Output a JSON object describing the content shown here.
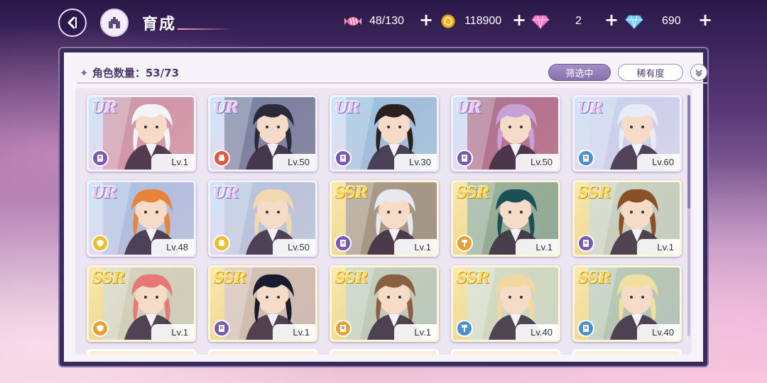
{
  "header": {
    "title": "育成",
    "resources": [
      {
        "name": "candy",
        "icon": "candy-icon",
        "value": "48/130"
      },
      {
        "name": "coin",
        "icon": "coin-icon",
        "value": "118900"
      },
      {
        "name": "pink-gem",
        "icon": "pink-diamond-icon",
        "value": "2"
      },
      {
        "name": "blue-gem",
        "icon": "blue-diamond-icon",
        "value": "690"
      }
    ]
  },
  "panel": {
    "count_label": "角色数量：53/73",
    "filter_label": "筛选中",
    "sort_label": "稀有度"
  },
  "cards": [
    {
      "rarity": "UR",
      "level": "Lv.1",
      "attr": "purple",
      "icon": "book-icon",
      "bg": "#c06070",
      "hair": "#f4f4f8"
    },
    {
      "rarity": "UR",
      "level": "Lv.50",
      "attr": "red",
      "icon": "fist-icon",
      "bg": "#2a3a60",
      "hair": "#2a2a38"
    },
    {
      "rarity": "UR",
      "level": "Lv.30",
      "attr": "purple",
      "icon": "book-icon",
      "bg": "#6aa8c8",
      "hair": "#2a2020"
    },
    {
      "rarity": "UR",
      "level": "Lv.50",
      "attr": "purple",
      "icon": "book-icon",
      "bg": "#8a2040",
      "hair": "#c8a0d8"
    },
    {
      "rarity": "UR",
      "level": "Lv.60",
      "attr": "blue",
      "icon": "book-icon",
      "bg": "#b8c8e8",
      "hair": "#e8ecf8"
    },
    {
      "rarity": "UR",
      "level": "Lv.48",
      "attr": "yellow",
      "icon": "shield-icon",
      "bg": "#88a8d0",
      "hair": "#e8843a"
    },
    {
      "rarity": "UR",
      "level": "Lv.50",
      "attr": "yellow",
      "icon": "fist-icon",
      "bg": "#98b0c8",
      "hair": "#f0d8b0"
    },
    {
      "rarity": "SSR",
      "level": "Lv.1",
      "attr": "purple",
      "icon": "book-icon",
      "bg": "#6a6078",
      "hair": "#e8e8f0"
    },
    {
      "rarity": "SSR",
      "level": "Lv.1",
      "attr": "orange",
      "icon": "hammer-icon",
      "bg": "#4a8898",
      "hair": "#1a5058"
    },
    {
      "rarity": "SSR",
      "level": "Lv.1",
      "attr": "purple",
      "icon": "book-icon",
      "bg": "#a8c8e0",
      "hair": "#8a5028"
    },
    {
      "rarity": "SSR",
      "level": "Lv.1",
      "attr": "orange",
      "icon": "shield-icon",
      "bg": "#b8c8d8",
      "hair": "#e87878"
    },
    {
      "rarity": "SSR",
      "level": "Lv.1",
      "attr": "purple",
      "icon": "book-icon",
      "bg": "#b8a8c8",
      "hair": "#1a1a30"
    },
    {
      "rarity": "SSR",
      "level": "Lv.1",
      "attr": "orange",
      "icon": "book-icon",
      "bg": "#98c0d8",
      "hair": "#8a6040"
    },
    {
      "rarity": "SSR",
      "level": "Lv.40",
      "attr": "blue",
      "icon": "hammer-icon",
      "bg": "#b8d8e8",
      "hair": "#f0d8a0"
    },
    {
      "rarity": "SSR",
      "level": "Lv.40",
      "attr": "blue",
      "icon": "book-icon",
      "bg": "#88b8d0",
      "hair": "#f0e0a0"
    }
  ],
  "colors": {
    "purple": "#7a5ab0",
    "red": "#e05a40",
    "blue": "#4a90d0",
    "yellow": "#e8c030",
    "orange": "#e8a030"
  }
}
